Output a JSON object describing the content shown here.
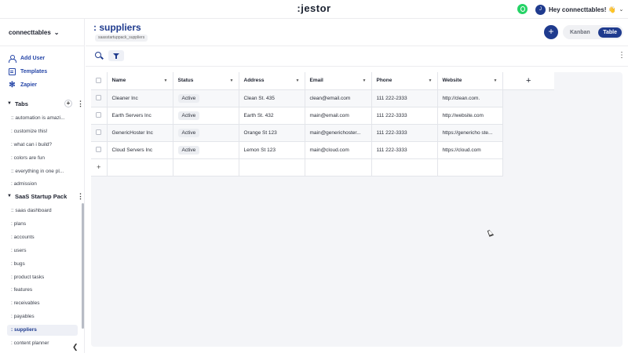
{
  "app": {
    "logo": ":jestor",
    "greeting": "Hey connecttables! 👋",
    "avatar_initial": "J"
  },
  "sidebar": {
    "workspace": "connecttables",
    "actions": [
      {
        "label": "Add User",
        "icon": "add-user-icon"
      },
      {
        "label": "Templates",
        "icon": "templates-icon"
      },
      {
        "label": "Zapier",
        "icon": "zapier-icon"
      }
    ],
    "tabs_section": {
      "title": "Tabs",
      "items": [
        ":: automation is amazi...",
        ": customize this!",
        ": what can i build?",
        ": colors are fun",
        ":: everything in one pl...",
        ": admission"
      ]
    },
    "pack_section": {
      "title": "SaaS Startup Pack",
      "items": [
        ":: saas dashboard",
        ": plans",
        ": accounts",
        ": users",
        ": bugs",
        ": product tasks",
        ": features",
        ": receivables",
        ": payables",
        ": suppliers",
        ": content planner"
      ],
      "active_index": 9
    }
  },
  "page": {
    "title": ": suppliers",
    "subtitle": "saasstartuppack_suppliers",
    "view_kanban": "Kanban",
    "view_table": "Table"
  },
  "table": {
    "columns": [
      "Name",
      "Status",
      "Address",
      "Email",
      "Phone",
      "Website"
    ],
    "rows": [
      {
        "name": "Cleaner Inc",
        "status": "Active",
        "address": "Clean St. 435",
        "email": "clean@email.com",
        "phone": "111 222-2333",
        "website": "http://clean.com."
      },
      {
        "name": "Earth Servers Inc",
        "status": "Active",
        "address": "Earth St. 432",
        "email": "main@email.com",
        "phone": "111 222-3333",
        "website": "http://website.com"
      },
      {
        "name": "GenericHoster Inc",
        "status": "Active",
        "address": "Orange St 123",
        "email": "main@generichoster...",
        "phone": "111 222-3333",
        "website": "https://genericho ste..."
      },
      {
        "name": "Cloud Servers Inc",
        "status": "Active",
        "address": "Lemon St 123",
        "email": "main@cloud.com",
        "phone": "111 222-3333",
        "website": "https://cloud.com"
      }
    ]
  },
  "colors": {
    "brand": "#1f3b8e",
    "link": "#2747a8",
    "whatsapp": "#25d366"
  }
}
